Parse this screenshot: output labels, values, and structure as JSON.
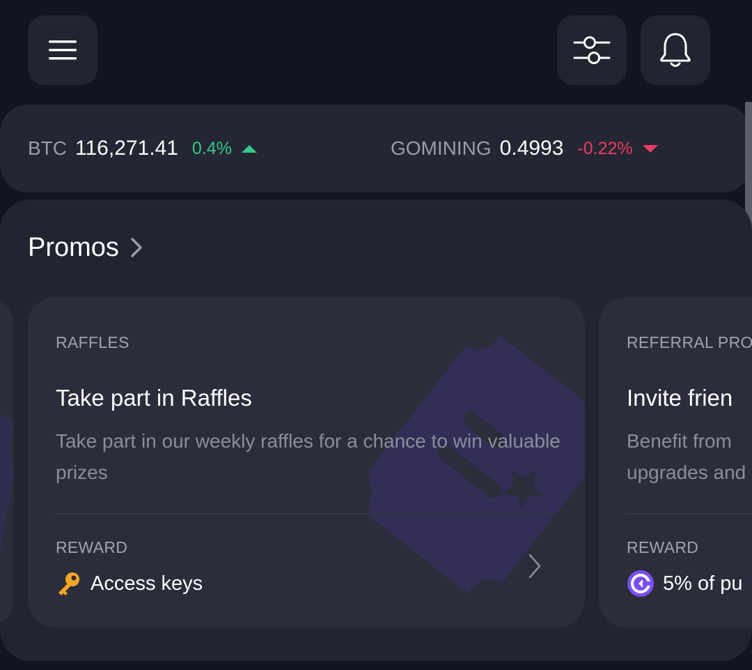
{
  "header": {
    "menu_icon": "hamburger-menu-icon",
    "filter_icon": "sliders-filter-icon",
    "notification_icon": "bell-icon"
  },
  "ticker": {
    "items": [
      {
        "symbol": "BTC",
        "price": "116,271.41",
        "change": "0.4%",
        "direction": "up"
      },
      {
        "symbol": "GOMINING",
        "price": "0.4993",
        "change": "-0.22%",
        "direction": "down"
      }
    ],
    "colors": {
      "up": "#34c98c",
      "down": "#ec3c62"
    }
  },
  "promos": {
    "title": "Promos",
    "cards": [
      {
        "tag": "RAFFLES",
        "title": "Take part in Raffles",
        "description": "Take part in our weekly raffles for a chance to win valuable prizes",
        "reward_label": "REWARD",
        "reward": "Access keys",
        "reward_icon": "key-icon"
      },
      {
        "tag": "REFERRAL PRO",
        "title": "Invite frien",
        "description": "Benefit from upgrades and",
        "reward_label": "REWARD",
        "reward": "5% of pu",
        "reward_icon": "gomining-token-icon"
      }
    ]
  }
}
